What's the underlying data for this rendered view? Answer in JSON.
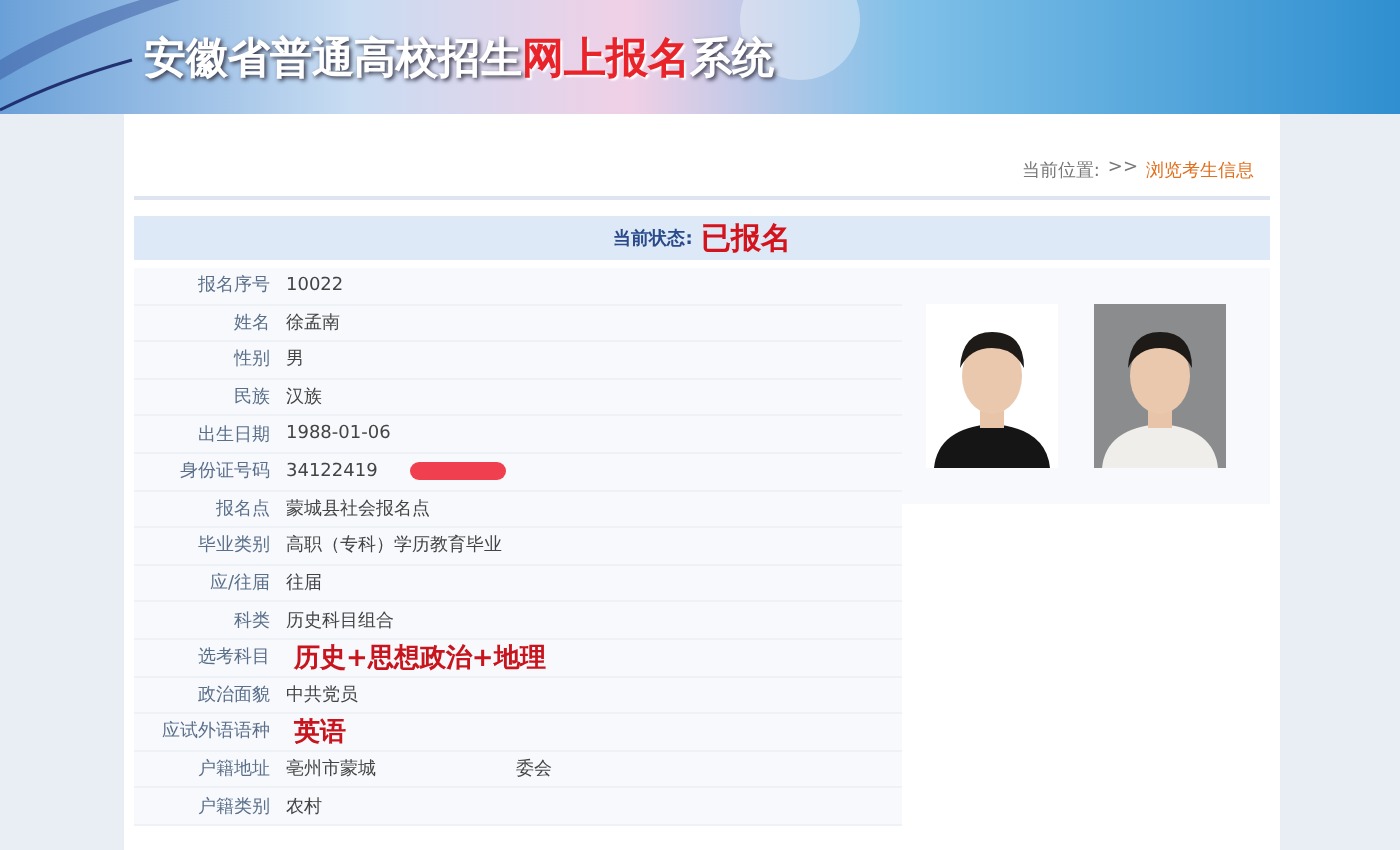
{
  "banner": {
    "title_parts": [
      {
        "text": "安徽省普通高校招生",
        "kind": "plain"
      },
      {
        "text": "网上报名",
        "kind": "accent"
      },
      {
        "text": "系统",
        "kind": "plain"
      }
    ]
  },
  "breadcrumb": {
    "label": "当前位置:",
    "separator": ">>",
    "current": "浏览考生信息"
  },
  "status": {
    "label": "当前状态:",
    "value": "已报名"
  },
  "fields": [
    {
      "label": "报名序号",
      "values": [
        "10022"
      ],
      "kind": "plain"
    },
    {
      "label": "姓名",
      "values": [
        "徐孟南"
      ],
      "kind": "plain"
    },
    {
      "label": "性别",
      "values": [
        "男"
      ],
      "kind": "plain"
    },
    {
      "label": "民族",
      "values": [
        "汉族"
      ],
      "kind": "plain"
    },
    {
      "label": "出生日期",
      "values": [
        "1988-01-06"
      ],
      "kind": "plain"
    },
    {
      "label": "身份证号码",
      "values": [
        "34122419"
      ],
      "kind": "redacted"
    },
    {
      "label": "报名点",
      "values": [
        "蒙城县社会报名点"
      ],
      "kind": "plain"
    },
    {
      "label": "毕业类别",
      "values": [
        "高职（专科）学历教育毕业"
      ],
      "kind": "plain"
    },
    {
      "label": "应/往届",
      "values": [
        "往届"
      ],
      "kind": "plain"
    },
    {
      "label": "科类",
      "values": [
        "历史科目组合"
      ],
      "kind": "plain"
    },
    {
      "label": "选考科目",
      "values": [
        "历史+思想政治+地理"
      ],
      "kind": "highlight"
    },
    {
      "label": "政治面貌",
      "values": [
        "中共党员"
      ],
      "kind": "plain"
    },
    {
      "label": "应试外语语种",
      "values": [
        "英语"
      ],
      "kind": "highlight"
    },
    {
      "label": "户籍地址",
      "values": [
        "亳州市蒙城",
        "委会"
      ],
      "kind": "blurred"
    },
    {
      "label": "户籍类别",
      "values": [
        "农村"
      ],
      "kind": "plain"
    }
  ]
}
